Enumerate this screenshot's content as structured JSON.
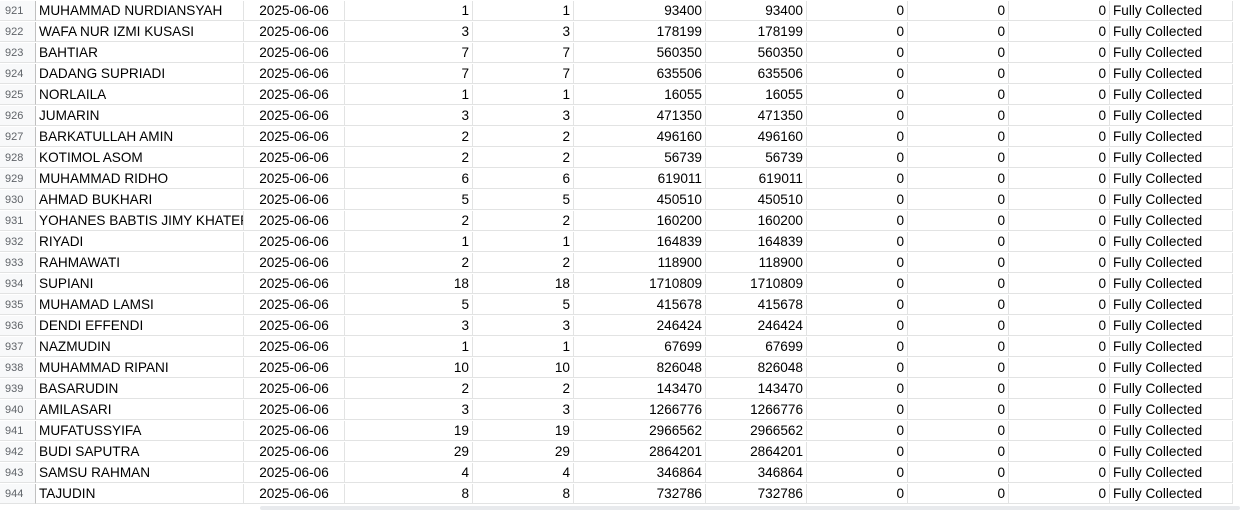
{
  "sheet": {
    "rows": [
      {
        "n": "921",
        "name": "MUHAMMAD NURDIANSYAH",
        "date": "2025-06-06",
        "a": "1",
        "b": "1",
        "c": "93400",
        "d": "93400",
        "e": "0",
        "f": "0",
        "g": "0",
        "status": "Fully Collected"
      },
      {
        "n": "922",
        "name": "WAFA NUR IZMI KUSASI",
        "date": "2025-06-06",
        "a": "3",
        "b": "3",
        "c": "178199",
        "d": "178199",
        "e": "0",
        "f": "0",
        "g": "0",
        "status": "Fully Collected"
      },
      {
        "n": "923",
        "name": "BAHTIAR",
        "date": "2025-06-06",
        "a": "7",
        "b": "7",
        "c": "560350",
        "d": "560350",
        "e": "0",
        "f": "0",
        "g": "0",
        "status": "Fully Collected"
      },
      {
        "n": "924",
        "name": "DADANG SUPRIADI",
        "date": "2025-06-06",
        "a": "7",
        "b": "7",
        "c": "635506",
        "d": "635506",
        "e": "0",
        "f": "0",
        "g": "0",
        "status": "Fully Collected"
      },
      {
        "n": "925",
        "name": "NORLAILA",
        "date": "2025-06-06",
        "a": "1",
        "b": "1",
        "c": "16055",
        "d": "16055",
        "e": "0",
        "f": "0",
        "g": "0",
        "status": "Fully Collected"
      },
      {
        "n": "926",
        "name": "JUMARIN",
        "date": "2025-06-06",
        "a": "3",
        "b": "3",
        "c": "471350",
        "d": "471350",
        "e": "0",
        "f": "0",
        "g": "0",
        "status": "Fully Collected"
      },
      {
        "n": "927",
        "name": "BARKATULLAH AMIN",
        "date": "2025-06-06",
        "a": "2",
        "b": "2",
        "c": "496160",
        "d": "496160",
        "e": "0",
        "f": "0",
        "g": "0",
        "status": "Fully Collected"
      },
      {
        "n": "928",
        "name": "KOTIMOL ASOM",
        "date": "2025-06-06",
        "a": "2",
        "b": "2",
        "c": "56739",
        "d": "56739",
        "e": "0",
        "f": "0",
        "g": "0",
        "status": "Fully Collected"
      },
      {
        "n": "929",
        "name": "MUHAMMAD RIDHO",
        "date": "2025-06-06",
        "a": "6",
        "b": "6",
        "c": "619011",
        "d": "619011",
        "e": "0",
        "f": "0",
        "g": "0",
        "status": "Fully Collected"
      },
      {
        "n": "930",
        "name": "AHMAD BUKHARI",
        "date": "2025-06-06",
        "a": "5",
        "b": "5",
        "c": "450510",
        "d": "450510",
        "e": "0",
        "f": "0",
        "g": "0",
        "status": "Fully Collected"
      },
      {
        "n": "931",
        "name": "YOHANES BABTIS JIMY KHATER",
        "date": "2025-06-06",
        "a": "2",
        "b": "2",
        "c": "160200",
        "d": "160200",
        "e": "0",
        "f": "0",
        "g": "0",
        "status": "Fully Collected"
      },
      {
        "n": "932",
        "name": "RIYADI",
        "date": "2025-06-06",
        "a": "1",
        "b": "1",
        "c": "164839",
        "d": "164839",
        "e": "0",
        "f": "0",
        "g": "0",
        "status": "Fully Collected"
      },
      {
        "n": "933",
        "name": "RAHMAWATI",
        "date": "2025-06-06",
        "a": "2",
        "b": "2",
        "c": "118900",
        "d": "118900",
        "e": "0",
        "f": "0",
        "g": "0",
        "status": "Fully Collected"
      },
      {
        "n": "934",
        "name": "SUPIANI",
        "date": "2025-06-06",
        "a": "18",
        "b": "18",
        "c": "1710809",
        "d": "1710809",
        "e": "0",
        "f": "0",
        "g": "0",
        "status": "Fully Collected"
      },
      {
        "n": "935",
        "name": "MUHAMAD LAMSI",
        "date": "2025-06-06",
        "a": "5",
        "b": "5",
        "c": "415678",
        "d": "415678",
        "e": "0",
        "f": "0",
        "g": "0",
        "status": "Fully Collected"
      },
      {
        "n": "936",
        "name": "DENDI EFFENDI",
        "date": "2025-06-06",
        "a": "3",
        "b": "3",
        "c": "246424",
        "d": "246424",
        "e": "0",
        "f": "0",
        "g": "0",
        "status": "Fully Collected"
      },
      {
        "n": "937",
        "name": "NAZMUDIN",
        "date": "2025-06-06",
        "a": "1",
        "b": "1",
        "c": "67699",
        "d": "67699",
        "e": "0",
        "f": "0",
        "g": "0",
        "status": "Fully Collected"
      },
      {
        "n": "938",
        "name": "MUHAMMAD RIPANI",
        "date": "2025-06-06",
        "a": "10",
        "b": "10",
        "c": "826048",
        "d": "826048",
        "e": "0",
        "f": "0",
        "g": "0",
        "status": "Fully Collected"
      },
      {
        "n": "939",
        "name": "BASARUDIN",
        "date": "2025-06-06",
        "a": "2",
        "b": "2",
        "c": "143470",
        "d": "143470",
        "e": "0",
        "f": "0",
        "g": "0",
        "status": "Fully Collected"
      },
      {
        "n": "940",
        "name": "AMILASARI",
        "date": "2025-06-06",
        "a": "3",
        "b": "3",
        "c": "1266776",
        "d": "1266776",
        "e": "0",
        "f": "0",
        "g": "0",
        "status": "Fully Collected"
      },
      {
        "n": "941",
        "name": "MUFATUSSYIFA",
        "date": "2025-06-06",
        "a": "19",
        "b": "19",
        "c": "2966562",
        "d": "2966562",
        "e": "0",
        "f": "0",
        "g": "0",
        "status": "Fully Collected"
      },
      {
        "n": "942",
        "name": "BUDI SAPUTRA",
        "date": "2025-06-06",
        "a": "29",
        "b": "29",
        "c": "2864201",
        "d": "2864201",
        "e": "0",
        "f": "0",
        "g": "0",
        "status": "Fully Collected"
      },
      {
        "n": "943",
        "name": "SAMSU RAHMAN",
        "date": "2025-06-06",
        "a": "4",
        "b": "4",
        "c": "346864",
        "d": "346864",
        "e": "0",
        "f": "0",
        "g": "0",
        "status": "Fully Collected"
      },
      {
        "n": "944",
        "name": "TAJUDIN",
        "date": "2025-06-06",
        "a": "8",
        "b": "8",
        "c": "732786",
        "d": "732786",
        "e": "0",
        "f": "0",
        "g": "0",
        "status": "Fully Collected"
      }
    ]
  }
}
